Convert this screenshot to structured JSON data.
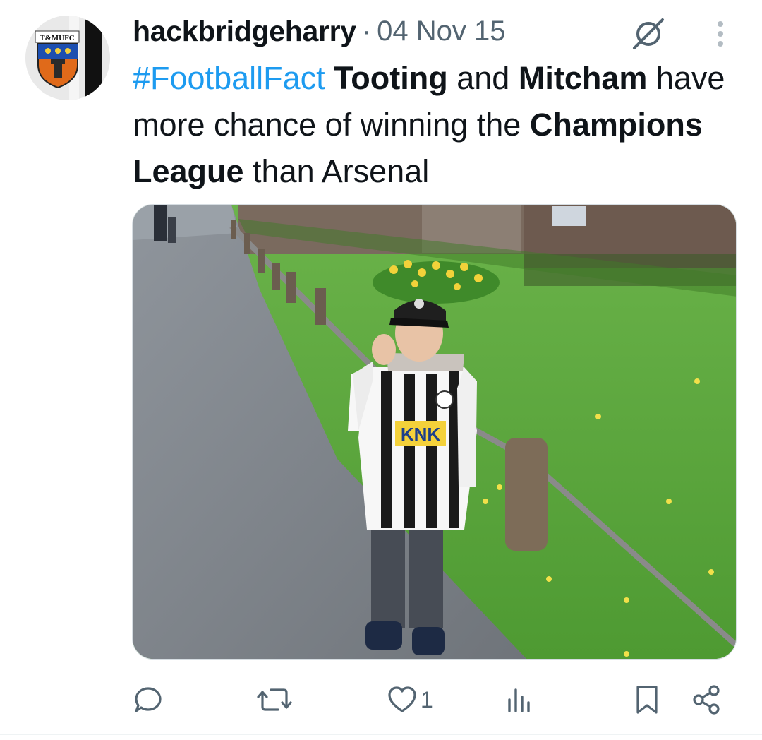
{
  "post": {
    "username": "hackbridgeharry",
    "separator": "·",
    "date": "04 Nov 15",
    "avatar_badge_text": "T&MUFC",
    "text": {
      "hashtag": "#FootballFact",
      "w1": "Tooting",
      "w2": " and ",
      "w3": "Mitcham",
      "w4": " have more chance of winning the ",
      "w5": "Champions League",
      "w6": " than Arsenal"
    },
    "media": {
      "shirt_sponsor": "KNK"
    }
  },
  "actions": {
    "reply_icon": "reply-bubble-icon",
    "repost_icon": "repost-icon",
    "like_icon": "heart-icon",
    "like_count": "1",
    "views_icon": "views-bar-chart-icon",
    "bookmark_icon": "bookmark-icon",
    "share_icon": "share-icon"
  },
  "colors": {
    "accent": "#1d9bf0",
    "text": "#0f1419",
    "muted": "#536471"
  }
}
